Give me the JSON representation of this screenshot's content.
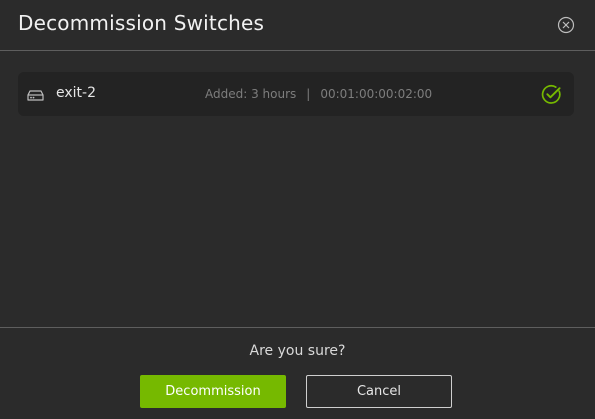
{
  "dialog": {
    "title": "Decommission Switches",
    "close_icon": "close-circle-icon"
  },
  "switches": [
    {
      "icon": "switch-device-icon",
      "name": "exit-2",
      "added": "Added: 3 hours",
      "separator": "|",
      "mac": "00:01:00:00:02:00",
      "status_icon": "check-circle-icon"
    }
  ],
  "footer": {
    "confirm_text": "Are you sure?",
    "decommission_label": "Decommission",
    "cancel_label": "Cancel"
  },
  "colors": {
    "background": "#2b2b2b",
    "row_background": "#232323",
    "accent": "#76b900",
    "divider": "#5e5e5e"
  }
}
